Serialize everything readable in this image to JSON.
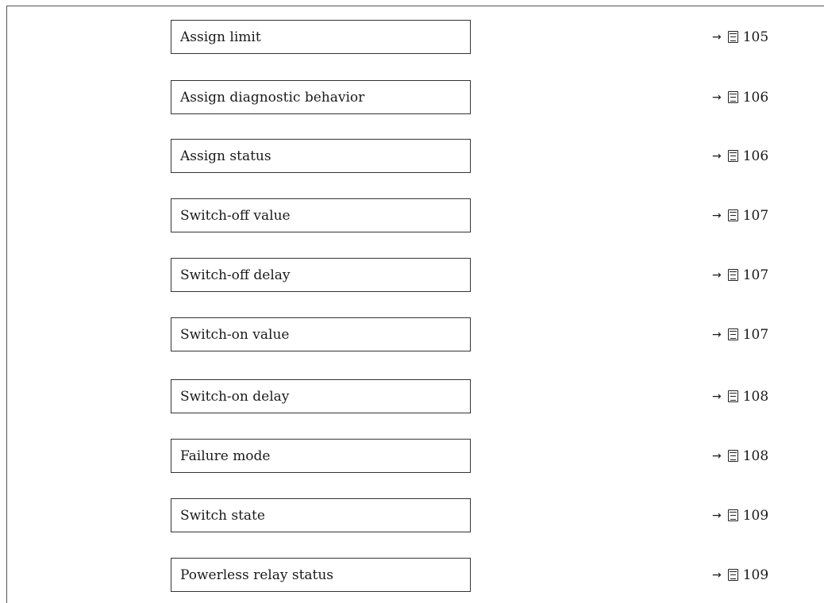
{
  "parameters": [
    {
      "label": "Assign limit",
      "page": "105"
    },
    {
      "label": "Assign diagnostic behavior",
      "page": "106"
    },
    {
      "label": "Assign status",
      "page": "106"
    },
    {
      "label": "Switch-off value",
      "page": "107"
    },
    {
      "label": "Switch-off delay",
      "page": "107"
    },
    {
      "label": "Switch-on value",
      "page": "107"
    },
    {
      "label": "Switch-on delay",
      "page": "108"
    },
    {
      "label": "Failure mode",
      "page": "108"
    },
    {
      "label": "Switch state",
      "page": "109"
    },
    {
      "label": "Powerless relay status",
      "page": "109"
    }
  ],
  "icons": {
    "arrow": "arrow-right-icon",
    "page": "page-reference-icon"
  }
}
